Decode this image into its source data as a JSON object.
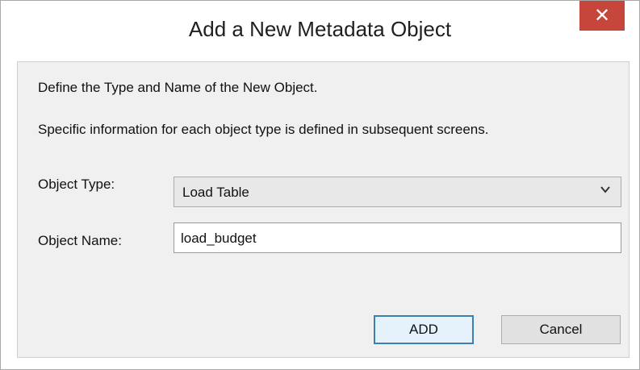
{
  "dialog": {
    "title": "Add a New Metadata Object",
    "close_glyph": "✕"
  },
  "body": {
    "instruction_1": "Define the Type and Name of the New Object.",
    "instruction_2": "Specific information for each object type is defined in subsequent screens."
  },
  "form": {
    "object_type_label": "Object Type:",
    "object_type_value": "Load Table",
    "object_name_label": "Object Name:",
    "object_name_value": "load_budget"
  },
  "buttons": {
    "add_label": "ADD",
    "cancel_label": "Cancel"
  },
  "icons": {
    "close": "close-icon",
    "dropdown": "chevron-down-icon"
  },
  "colors": {
    "close_button_bg": "#c7463c",
    "default_button_border": "#3c7fb1",
    "panel_bg": "#f0f0f0"
  }
}
